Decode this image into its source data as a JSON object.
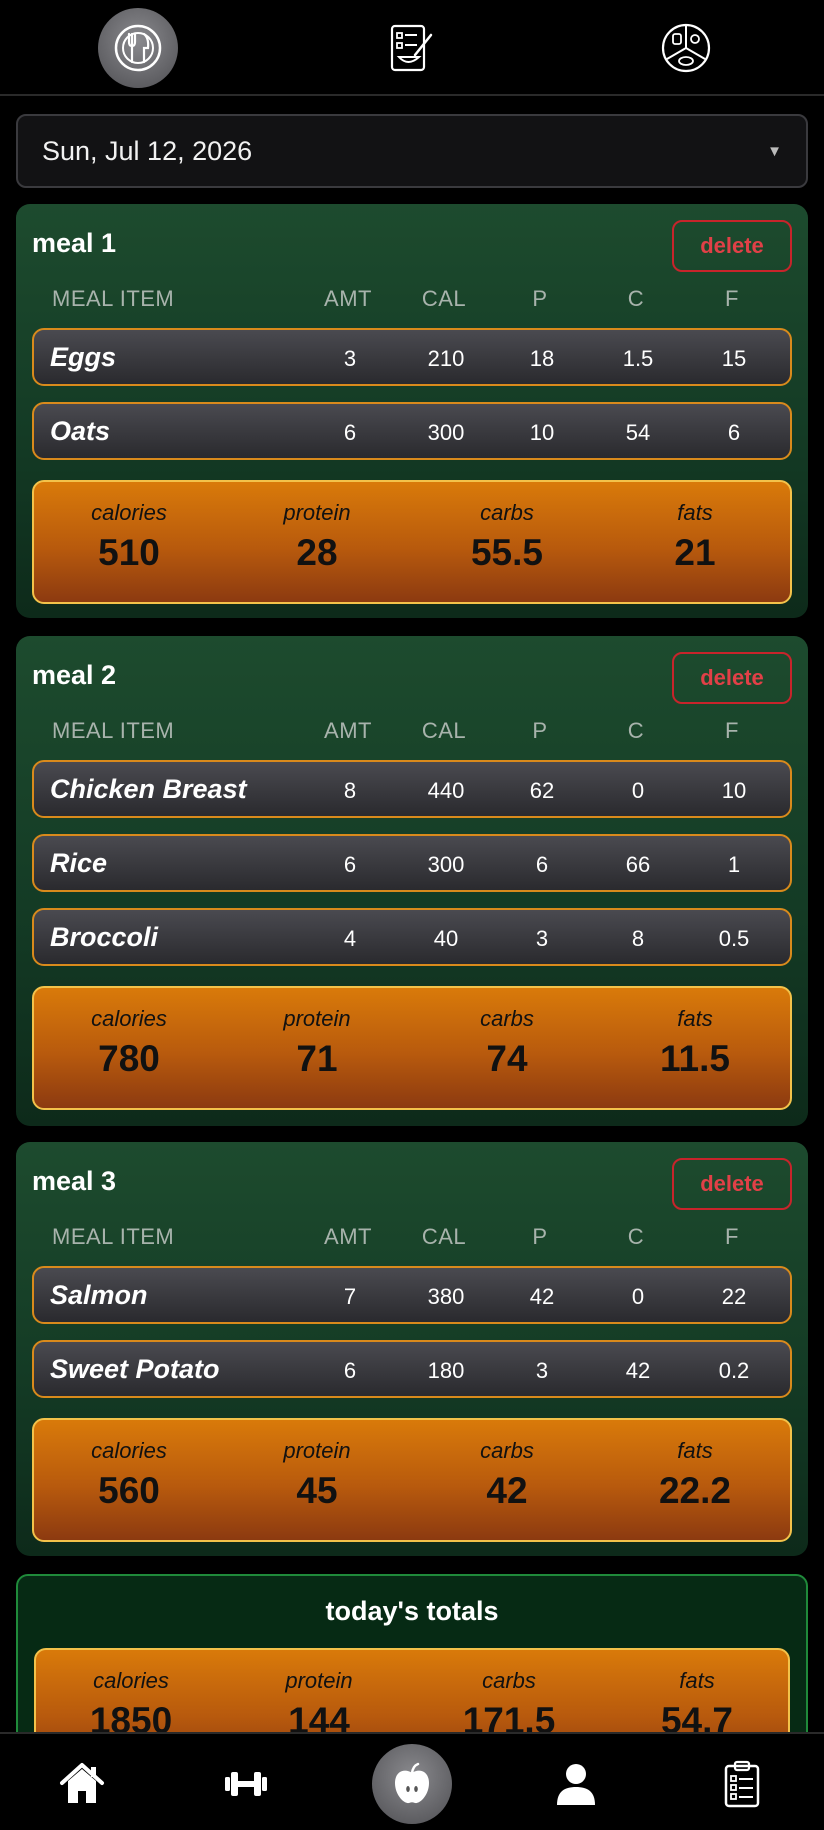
{
  "top_tabs": [
    {
      "icon": "plate-utensils-icon",
      "active": true
    },
    {
      "icon": "recipe-list-icon",
      "active": false
    },
    {
      "icon": "food-plate-macros-icon",
      "active": false
    }
  ],
  "date_select": {
    "value": "Sun, Jul 12, 2026",
    "caret": "▼"
  },
  "columns": {
    "name": "MEAL ITEM",
    "amt": "AMT",
    "cal": "CAL",
    "p": "P",
    "c": "C",
    "f": "F"
  },
  "summary_labels": {
    "calories": "calories",
    "protein": "protein",
    "carbs": "carbs",
    "fats": "fats"
  },
  "delete_label": "delete",
  "meals": [
    {
      "title": "meal 1",
      "items": [
        {
          "name": "Eggs",
          "amt": "3",
          "cal": "210",
          "p": "18",
          "c": "1.5",
          "f": "15"
        },
        {
          "name": "Oats",
          "amt": "6",
          "cal": "300",
          "p": "10",
          "c": "54",
          "f": "6"
        }
      ],
      "totals": {
        "calories": "510",
        "protein": "28",
        "carbs": "55.5",
        "fats": "21"
      }
    },
    {
      "title": "meal 2",
      "items": [
        {
          "name": "Chicken Breast",
          "amt": "8",
          "cal": "440",
          "p": "62",
          "c": "0",
          "f": "10"
        },
        {
          "name": "Rice",
          "amt": "6",
          "cal": "300",
          "p": "6",
          "c": "66",
          "f": "1"
        },
        {
          "name": "Broccoli",
          "amt": "4",
          "cal": "40",
          "p": "3",
          "c": "8",
          "f": "0.5"
        }
      ],
      "totals": {
        "calories": "780",
        "protein": "71",
        "carbs": "74",
        "fats": "11.5"
      }
    },
    {
      "title": "meal 3",
      "items": [
        {
          "name": "Salmon",
          "amt": "7",
          "cal": "380",
          "p": "42",
          "c": "0",
          "f": "22"
        },
        {
          "name": "Sweet Potato",
          "amt": "6",
          "cal": "180",
          "p": "3",
          "c": "42",
          "f": "0.2"
        }
      ],
      "totals": {
        "calories": "560",
        "protein": "45",
        "carbs": "42",
        "fats": "22.2"
      }
    }
  ],
  "todays_totals": {
    "title": "today's totals",
    "calories": "1850",
    "protein": "144",
    "carbs": "171.5",
    "fats": "54.7"
  },
  "bottom_nav": [
    {
      "icon": "home-icon",
      "active": false
    },
    {
      "icon": "dumbbell-icon",
      "active": false
    },
    {
      "icon": "apple-icon",
      "active": true
    },
    {
      "icon": "user-icon",
      "active": false
    },
    {
      "icon": "clipboard-icon",
      "active": false
    }
  ],
  "colors": {
    "card_green": "#1d4b2e",
    "row_border_orange": "#d98a1c",
    "summary_orange": "#d97a0a",
    "delete_red": "#c8242b",
    "totals_border_green": "#1f8a3a"
  }
}
